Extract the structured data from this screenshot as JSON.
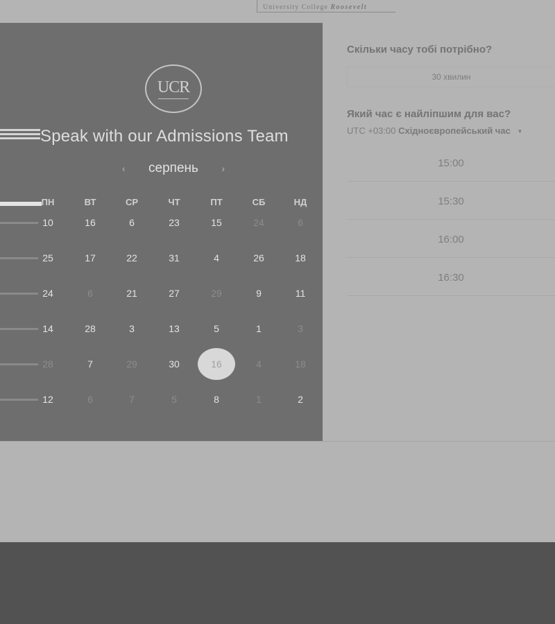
{
  "header": {
    "logo_text_plain": "University College",
    "logo_text_italic": "Roosevelt"
  },
  "calendar": {
    "logo_text": "UCR",
    "title": "Speak with our Admissions Team",
    "month": "серпень",
    "prev_icon": "chevron-left-icon",
    "next_icon": "chevron-right-icon",
    "weekdays": [
      "ПН",
      "ВТ",
      "СР",
      "ЧТ",
      "ПТ",
      "СБ",
      "НД"
    ],
    "weeks": [
      [
        {
          "d": "10",
          "m": false
        },
        {
          "d": "16",
          "m": false
        },
        {
          "d": "6",
          "m": false
        },
        {
          "d": "23",
          "m": false
        },
        {
          "d": "15",
          "m": false
        },
        {
          "d": "24",
          "m": true
        },
        {
          "d": "6",
          "m": true
        }
      ],
      [
        {
          "d": "25",
          "m": false
        },
        {
          "d": "17",
          "m": false
        },
        {
          "d": "22",
          "m": false
        },
        {
          "d": "31",
          "m": false
        },
        {
          "d": "4",
          "m": false
        },
        {
          "d": "26",
          "m": false
        },
        {
          "d": "18",
          "m": false
        }
      ],
      [
        {
          "d": "24",
          "m": false
        },
        {
          "d": "6",
          "m": true
        },
        {
          "d": "21",
          "m": false
        },
        {
          "d": "27",
          "m": false
        },
        {
          "d": "29",
          "m": true
        },
        {
          "d": "9",
          "m": false
        },
        {
          "d": "11",
          "m": false
        }
      ],
      [
        {
          "d": "14",
          "m": false
        },
        {
          "d": "28",
          "m": false
        },
        {
          "d": "3",
          "m": false
        },
        {
          "d": "13",
          "m": false
        },
        {
          "d": "5",
          "m": false
        },
        {
          "d": "1",
          "m": false
        },
        {
          "d": "3",
          "m": true
        }
      ],
      [
        {
          "d": "28",
          "m": true
        },
        {
          "d": "7",
          "m": false
        },
        {
          "d": "29",
          "m": true
        },
        {
          "d": "30",
          "m": false
        },
        {
          "d": "16",
          "m": false,
          "selected": true
        },
        {
          "d": "4",
          "m": true
        },
        {
          "d": "18",
          "m": true
        }
      ],
      [
        {
          "d": "12",
          "m": false
        },
        {
          "d": "6",
          "m": true
        },
        {
          "d": "7",
          "m": true
        },
        {
          "d": "5",
          "m": true
        },
        {
          "d": "8",
          "m": false
        },
        {
          "d": "1",
          "m": true
        },
        {
          "d": "2",
          "m": false
        }
      ]
    ]
  },
  "booking": {
    "duration_question": "Скільки часу тобі потрібно?",
    "duration_value": "30 хвилин",
    "time_question": "Який час є найліпшим для вас?",
    "timezone_offset": "UTC +03:00",
    "timezone_name": "Східноєвропейський час",
    "timezone_caret_icon": "caret-down-icon",
    "slots": [
      "15:00",
      "15:30",
      "16:00",
      "16:30"
    ]
  },
  "colors": {
    "calendar_bg": "#6e6e6e",
    "page_bg": "#b4b4b4",
    "footer_bg": "#525252",
    "selected_day": "#d8d8d8"
  }
}
